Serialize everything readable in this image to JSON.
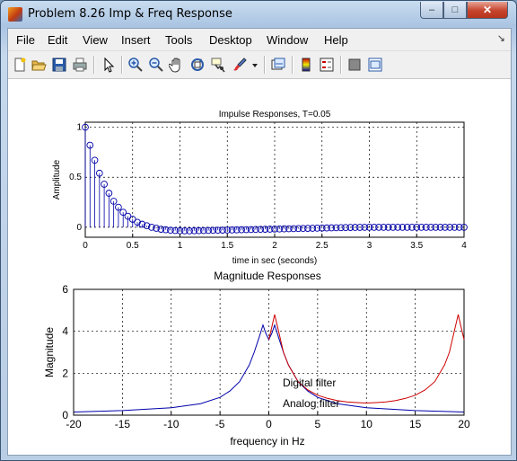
{
  "window": {
    "title": "Problem 8.26 Imp & Freq Response",
    "controls": {
      "minimize": "–",
      "maximize": "□",
      "close": "✕"
    }
  },
  "menu": {
    "items": [
      "File",
      "Edit",
      "View",
      "Insert",
      "Tools",
      "Desktop",
      "Window",
      "Help"
    ],
    "overflow_arrow": "↘"
  },
  "toolbar": {
    "icons": [
      "new-figure-icon",
      "open-file-icon",
      "save-icon",
      "print-icon",
      "edit-plot-arrow-icon",
      "zoom-in-icon",
      "zoom-out-icon",
      "pan-hand-icon",
      "rotate-3d-icon",
      "data-cursor-icon",
      "brush-icon",
      "brush-dropdown-icon",
      "link-plot-icon",
      "colorbar-icon",
      "legend-icon",
      "hide-plot-tools-icon",
      "show-plot-tools-icon"
    ]
  },
  "chart_data": [
    {
      "type": "stem",
      "title": "Impulse Responses, T=0.05",
      "xlabel": "time in sec (seconds)",
      "ylabel": "Amplitude",
      "xlim": [
        0,
        4
      ],
      "ylim": [
        -0.1,
        1.05
      ],
      "xticks": [
        "0",
        "0.5",
        "1",
        "1.5",
        "2",
        "2.5",
        "3",
        "3.5",
        "4"
      ],
      "yticks": [
        "0",
        "0.5",
        "1"
      ],
      "grid": true,
      "step": 0.05,
      "values": [
        1.0,
        0.82,
        0.67,
        0.54,
        0.43,
        0.34,
        0.26,
        0.2,
        0.15,
        0.11,
        0.08,
        0.05,
        0.03,
        0.015,
        0.0,
        -0.01,
        -0.02,
        -0.025,
        -0.03,
        -0.033,
        -0.035,
        -0.036,
        -0.036,
        -0.035,
        -0.034,
        -0.033,
        -0.032,
        -0.031,
        -0.03,
        -0.029,
        -0.028,
        -0.027,
        -0.026,
        -0.025,
        -0.024,
        -0.023,
        -0.022,
        -0.021,
        -0.02,
        -0.019,
        -0.018,
        -0.017,
        -0.016,
        -0.015,
        -0.014,
        -0.013,
        -0.012,
        -0.011,
        -0.01,
        -0.009,
        -0.008,
        -0.007,
        -0.006,
        -0.005,
        -0.004,
        -0.003,
        -0.002,
        -0.0015,
        -0.001,
        -0.0005,
        0.0,
        0.0,
        0.0,
        0.0,
        0.0,
        0.0,
        0.0,
        0.0,
        0.0,
        0.0,
        0.0,
        0.0,
        0.0,
        0.0,
        0.0,
        0.0,
        0.0,
        0.0,
        0.0,
        0.0,
        0.0
      ],
      "color": "#0000aa"
    },
    {
      "type": "line",
      "title": "Magnitude Responses",
      "xlabel": "frequency in Hz",
      "ylabel": "Magnitude",
      "xlim": [
        -20,
        20
      ],
      "ylim": [
        0,
        6
      ],
      "xticks": [
        "-20",
        "-15",
        "-10",
        "-5",
        "0",
        "5",
        "10",
        "15",
        "20"
      ],
      "yticks": [
        "0",
        "2",
        "4",
        "6"
      ],
      "grid": true,
      "annotations": [
        "Digital filter",
        "Analog filter"
      ],
      "series": [
        {
          "color": "#0000aa",
          "x": [
            -20,
            -15,
            -10,
            -7,
            -5,
            -4,
            -3,
            -2,
            -1.5,
            -1,
            -0.6,
            -0.3,
            0,
            0.3,
            0.6,
            1,
            1.5,
            2,
            3,
            4,
            5,
            7,
            10,
            15,
            20
          ],
          "y": [
            0.15,
            0.22,
            0.35,
            0.55,
            0.85,
            1.15,
            1.6,
            2.4,
            3.0,
            3.7,
            4.3,
            3.9,
            3.6,
            3.9,
            4.3,
            3.7,
            3.0,
            2.4,
            1.6,
            1.15,
            0.85,
            0.55,
            0.35,
            0.22,
            0.15
          ]
        },
        {
          "color": "#cc0000",
          "x": [
            0,
            0.3,
            0.6,
            1,
            1.5,
            2,
            3,
            4,
            5,
            6,
            7,
            8,
            9,
            10,
            11,
            12,
            13,
            14,
            15,
            16,
            17,
            18,
            18.5,
            19,
            19.4,
            19.7,
            20
          ],
          "y": [
            3.6,
            4.2,
            4.8,
            4.0,
            3.0,
            2.4,
            1.6,
            1.2,
            0.95,
            0.8,
            0.7,
            0.63,
            0.6,
            0.58,
            0.6,
            0.63,
            0.7,
            0.8,
            0.95,
            1.2,
            1.6,
            2.4,
            3.0,
            4.0,
            4.8,
            4.2,
            3.6
          ]
        }
      ]
    }
  ]
}
